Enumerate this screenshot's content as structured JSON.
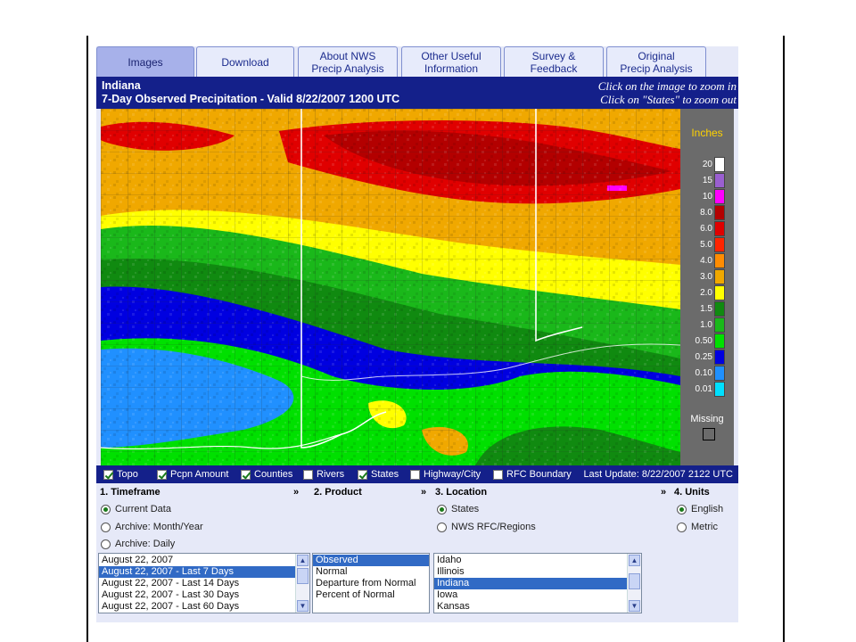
{
  "tabs": [
    {
      "line1": "Images",
      "line2": ""
    },
    {
      "line1": "Download",
      "line2": ""
    },
    {
      "line1": "About NWS",
      "line2": "Precip Analysis"
    },
    {
      "line1": "Other Useful",
      "line2": "Information"
    },
    {
      "line1": "Survey &",
      "line2": "Feedback"
    },
    {
      "line1": "Original",
      "line2": "Precip Analysis"
    }
  ],
  "header": {
    "state": "Indiana",
    "title": "7-Day Observed Precipitation - Valid 8/22/2007 1200 UTC",
    "hint1": "Click on the image to zoom in",
    "hint2": "Click on \"States\" to zoom out"
  },
  "legend": {
    "title": "Inches",
    "missing_label": "Missing",
    "items": [
      {
        "label": "20",
        "color": "#ffffff"
      },
      {
        "label": "15",
        "color": "#9a5fd0"
      },
      {
        "label": "10",
        "color": "#ff00ff"
      },
      {
        "label": "8.0",
        "color": "#b30000"
      },
      {
        "label": "6.0",
        "color": "#e00000"
      },
      {
        "label": "5.0",
        "color": "#ff2400"
      },
      {
        "label": "4.0",
        "color": "#ff8c00"
      },
      {
        "label": "3.0",
        "color": "#f0a800"
      },
      {
        "label": "2.0",
        "color": "#ffff00"
      },
      {
        "label": "1.5",
        "color": "#108a10"
      },
      {
        "label": "1.0",
        "color": "#1ab81a"
      },
      {
        "label": "0.50",
        "color": "#00e000"
      },
      {
        "label": "0.25",
        "color": "#0000e0"
      },
      {
        "label": "0.10",
        "color": "#2090ff"
      },
      {
        "label": "0.01",
        "color": "#00e0ff"
      }
    ]
  },
  "options": [
    {
      "label": "Topo",
      "checked": true
    },
    {
      "label": "Pcpn Amount",
      "checked": true
    },
    {
      "label": "Counties",
      "checked": true
    },
    {
      "label": "Rivers",
      "checked": false
    },
    {
      "label": "States",
      "checked": true
    },
    {
      "label": "Highway/City",
      "checked": false
    },
    {
      "label": "RFC Boundary",
      "checked": false
    }
  ],
  "last_update": "Last Update: 8/22/2007 2122 UTC",
  "sections": {
    "timeframe": "1. Timeframe",
    "product": "2. Product",
    "location": "3. Location",
    "units": "4. Units",
    "arrow": "»"
  },
  "timeframe": {
    "radios": [
      {
        "label": "Current Data",
        "checked": true
      },
      {
        "label": "Archive: Month/Year",
        "checked": false
      },
      {
        "label": "Archive: Daily",
        "checked": false
      }
    ],
    "list": [
      {
        "label": "August 22, 2007",
        "selected": false
      },
      {
        "label": "August 22, 2007 - Last 7 Days",
        "selected": true
      },
      {
        "label": "August 22, 2007 - Last 14 Days",
        "selected": false
      },
      {
        "label": "August 22, 2007 - Last 30 Days",
        "selected": false
      },
      {
        "label": "August 22, 2007 - Last 60 Days",
        "selected": false
      }
    ]
  },
  "product": {
    "list": [
      {
        "label": "Observed",
        "selected": true
      },
      {
        "label": "Normal",
        "selected": false
      },
      {
        "label": "Departure from Normal",
        "selected": false
      },
      {
        "label": "Percent of Normal",
        "selected": false
      }
    ]
  },
  "location": {
    "radios": [
      {
        "label": "States",
        "checked": true
      },
      {
        "label": "NWS RFC/Regions",
        "checked": false
      }
    ],
    "list": [
      {
        "label": "Idaho",
        "selected": false
      },
      {
        "label": "Illinois",
        "selected": false
      },
      {
        "label": "Indiana",
        "selected": true
      },
      {
        "label": "Iowa",
        "selected": false
      },
      {
        "label": "Kansas",
        "selected": false
      }
    ]
  },
  "units": {
    "radios": [
      {
        "label": "English",
        "checked": true
      },
      {
        "label": "Metric",
        "checked": false
      }
    ]
  }
}
